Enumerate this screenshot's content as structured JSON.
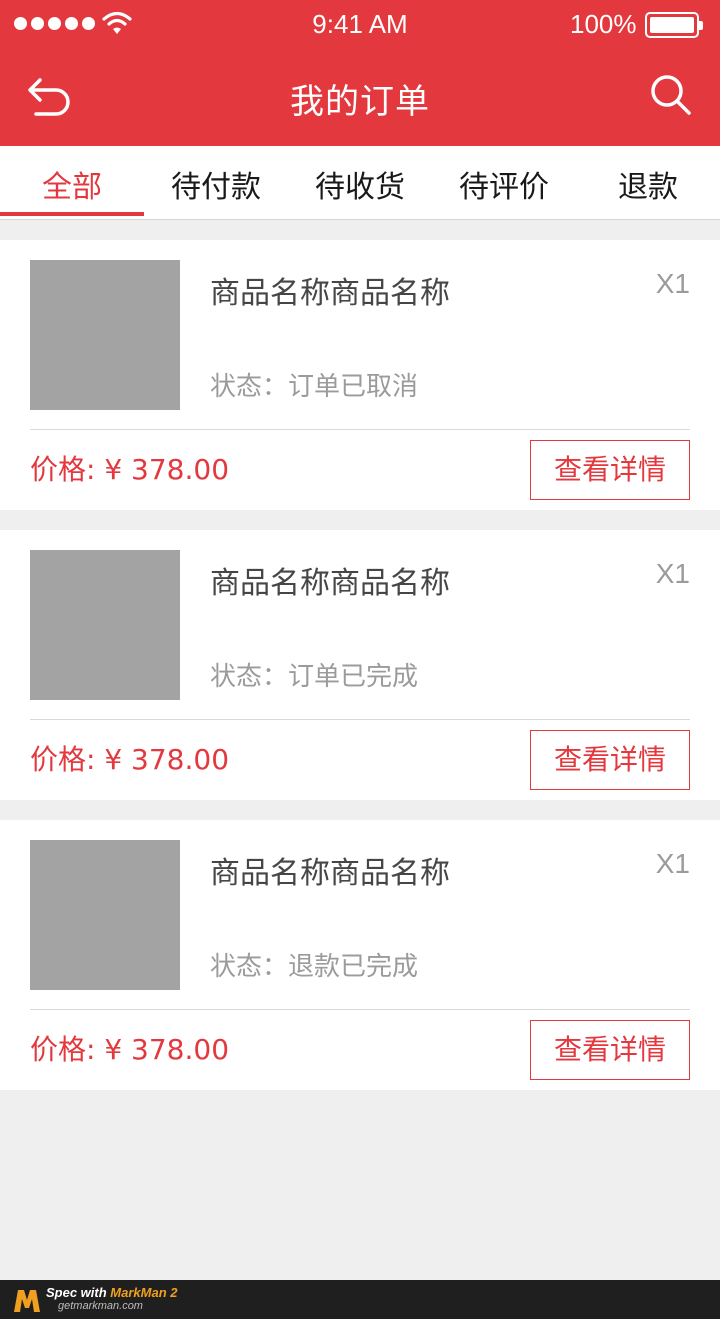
{
  "status_bar": {
    "time": "9:41 AM",
    "battery_percent": "100%",
    "signal_icon": "signal-dots-icon",
    "wifi_icon": "wifi-icon",
    "battery_icon": "battery-icon"
  },
  "nav": {
    "title": "我的订单",
    "back_icon": "back-arrow-icon",
    "search_icon": "search-icon"
  },
  "tabs": [
    {
      "label": "全部",
      "active": true
    },
    {
      "label": "待付款",
      "active": false
    },
    {
      "label": "待收货",
      "active": false
    },
    {
      "label": "待评价",
      "active": false
    },
    {
      "label": "退款",
      "active": false
    }
  ],
  "orders": [
    {
      "name": "商品名称商品名称",
      "qty": "X1",
      "status": "状态：订单已取消",
      "price": "价格: ¥ 378.00",
      "button": "查看详情"
    },
    {
      "name": "商品名称商品名称",
      "qty": "X1",
      "status": "状态：订单已完成",
      "price": "价格: ¥ 378.00",
      "button": "查看详情"
    },
    {
      "name": "商品名称商品名称",
      "qty": "X1",
      "status": "状态：退款已完成",
      "price": "价格: ¥ 378.00",
      "button": "查看详情"
    }
  ],
  "footer": {
    "spec_with": "Spec with ",
    "brand": "MarkMan 2",
    "site": "getmarkman.com"
  },
  "colors": {
    "accent": "#e3383e",
    "title_text": "#191919",
    "product_text": "#464646",
    "muted_text": "#9b9b9b",
    "thumbnail": "#a3a3a3",
    "background": "#efefef"
  }
}
